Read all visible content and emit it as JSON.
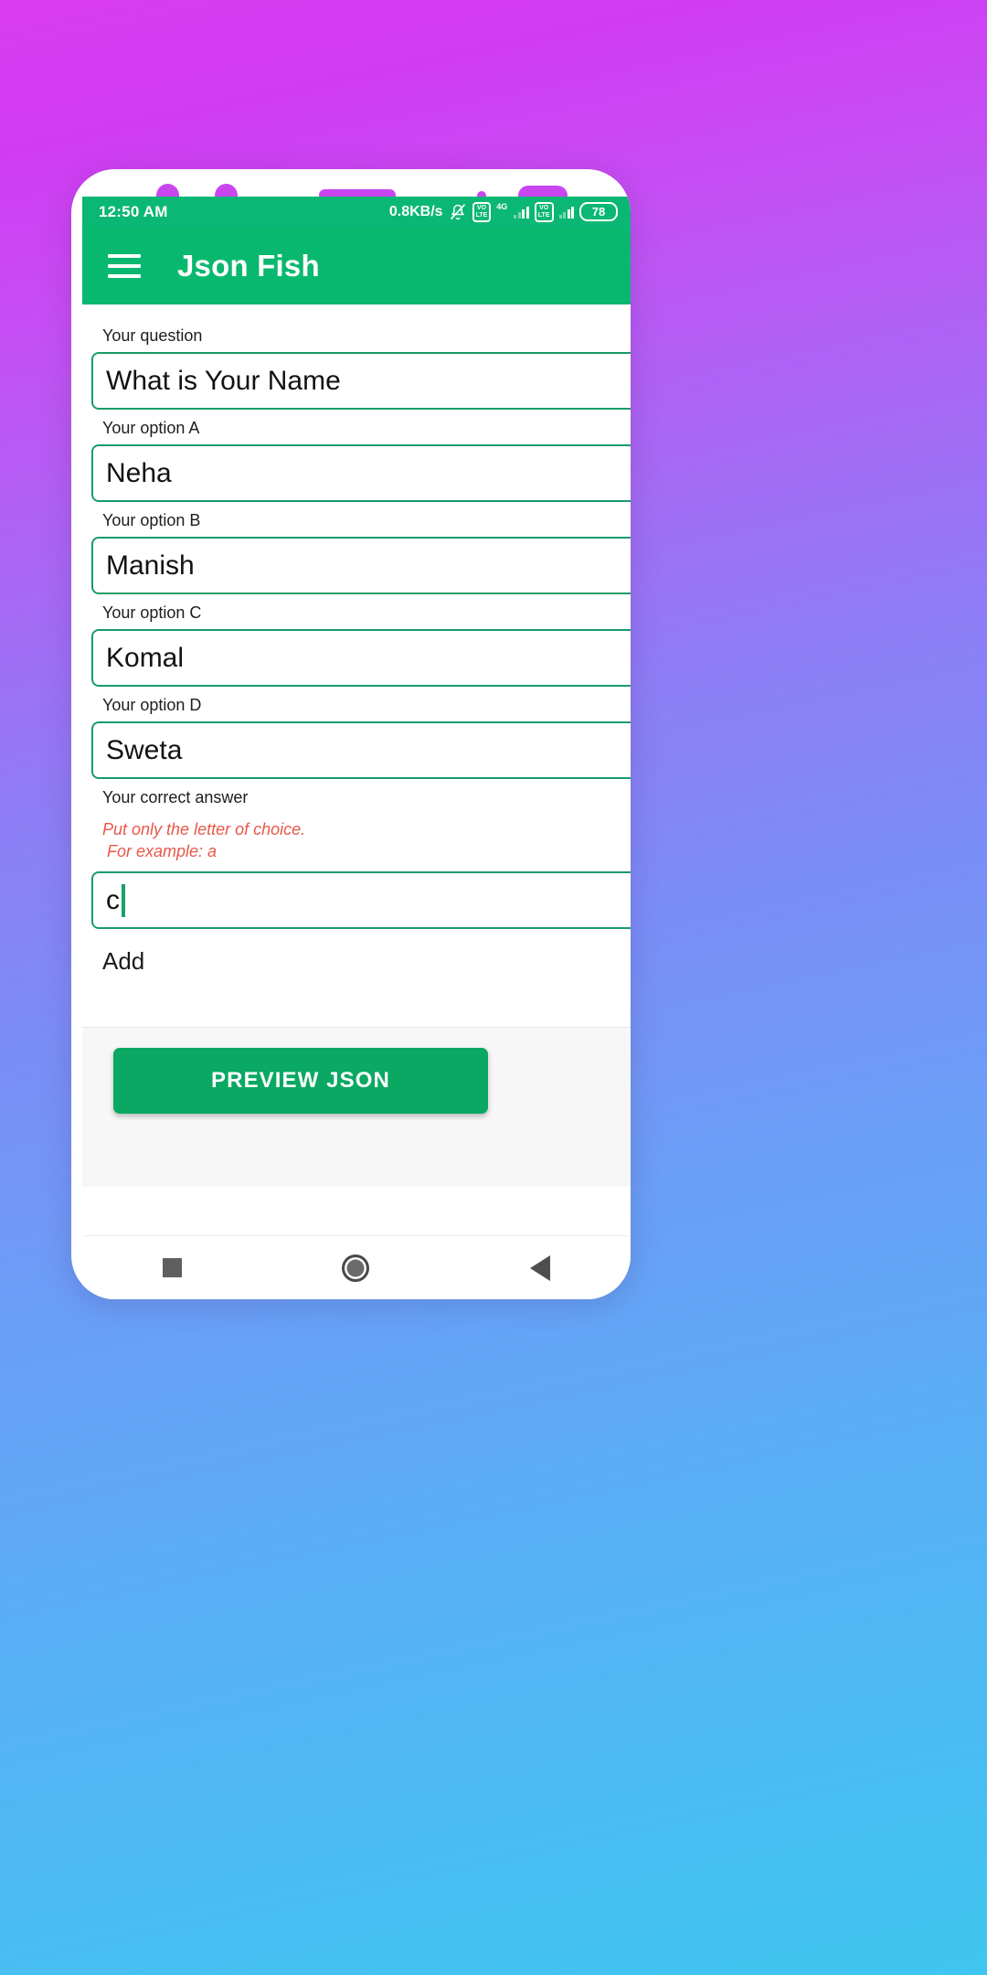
{
  "background": {
    "gradient_from": "#d93df0",
    "gradient_to": "#3fc6f0"
  },
  "phone_frame": {
    "accent_color": "#c946ef",
    "decorations": [
      "camera-dot",
      "camera-dot",
      "speaker-bar",
      "sensor-dot",
      "sensor-pill"
    ]
  },
  "statusbar": {
    "time": "12:50 AM",
    "network_speed": "0.8KB/s",
    "silent_icon": "bell-off-icon",
    "volte_label_1": "VO",
    "volte_sub_1": "LTE",
    "network_type": "4G",
    "volte_label_2": "VO",
    "volte_sub_2": "LTE",
    "battery_level": "78",
    "background_color": "#0bb774"
  },
  "appbar": {
    "menu_icon": "hamburger-menu-icon",
    "title": "Json Fish",
    "background_color": "#09b86f"
  },
  "form": {
    "fields": [
      {
        "label": "Your question",
        "value": "What is Your Name",
        "name": "question"
      },
      {
        "label": "Your option A",
        "value": "Neha",
        "name": "option-a"
      },
      {
        "label": "Your option B",
        "value": "Manish",
        "name": "option-b"
      },
      {
        "label": "Your option C",
        "value": "Komal",
        "name": "option-c"
      },
      {
        "label": "Your option D",
        "value": "Sweta",
        "name": "option-d"
      }
    ],
    "answer": {
      "label": "Your correct answer",
      "hint_line1": "Put only the letter of choice.",
      "hint_line2": "For example: a",
      "hint_color": "#e8584a",
      "value": "c"
    },
    "add_label": "Add",
    "border_color": "#1a9b68"
  },
  "bottom": {
    "preview_button": "PREVIEW JSON",
    "button_color": "#0aa862"
  },
  "navbar": {
    "recents": "square-recents-icon",
    "home": "circle-home-icon",
    "back": "triangle-back-icon"
  }
}
